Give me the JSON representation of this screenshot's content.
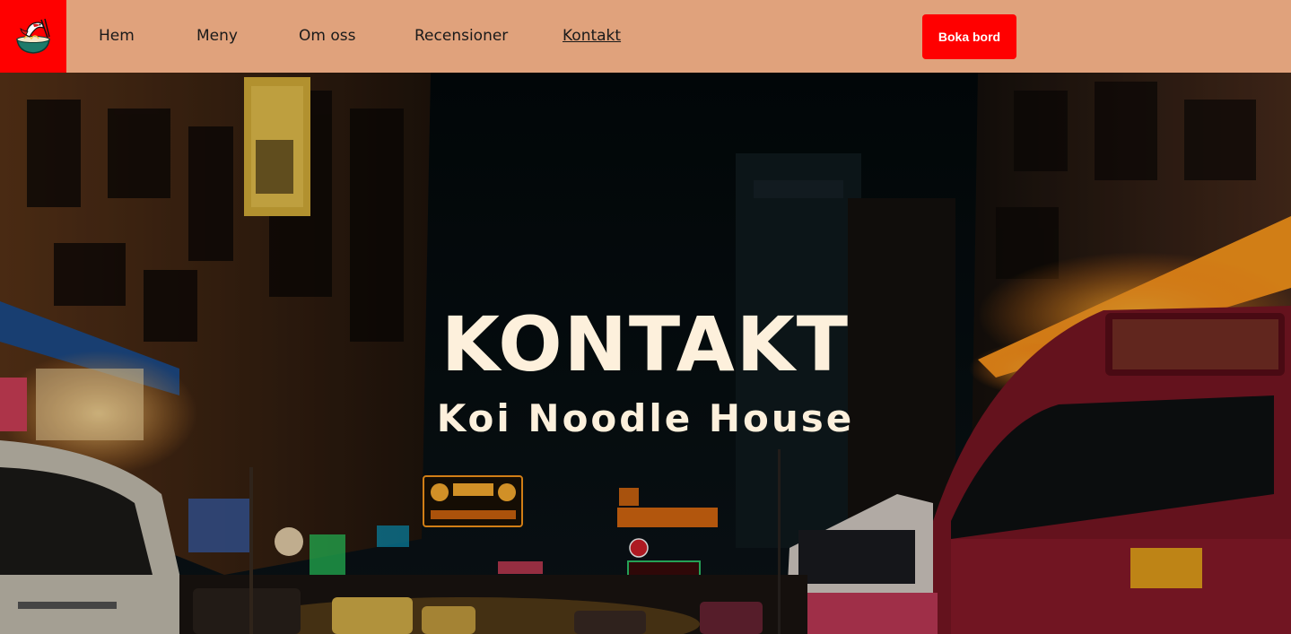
{
  "nav": {
    "items": [
      {
        "label": "Hem"
      },
      {
        "label": "Meny"
      },
      {
        "label": "Om oss"
      },
      {
        "label": "Recensioner"
      },
      {
        "label": "Kontakt",
        "active": true
      }
    ],
    "book_button": "Boka bord"
  },
  "hero": {
    "title": "KONTAKT",
    "subtitle": "Koi Noodle House"
  },
  "colors": {
    "nav_background": "#e0a27c",
    "accent": "#ff0000",
    "hero_text": "#fdf0dc"
  },
  "icons": {
    "logo": "koi-fish-noodle-bowl-icon"
  }
}
